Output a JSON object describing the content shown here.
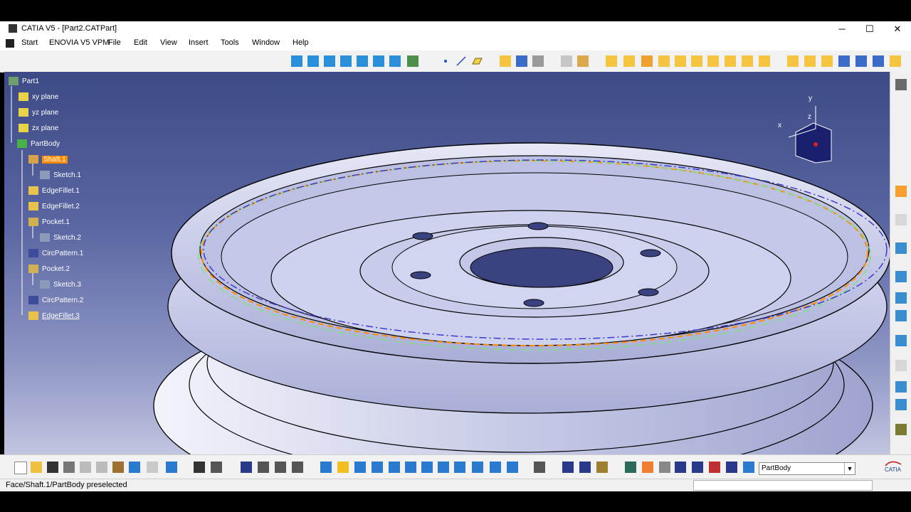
{
  "window": {
    "title": "CATIA V5 - [Part2.CATPart]",
    "min_glyph": "─",
    "max_glyph": "☐",
    "close_glyph": "✕"
  },
  "menu": {
    "items": [
      "Start",
      "ENOVIA V5 VPM",
      "File",
      "Edit",
      "View",
      "Insert",
      "Tools",
      "Window",
      "Help"
    ]
  },
  "tree": {
    "root": "Part1",
    "items": [
      {
        "label": "xy plane",
        "icon": "plane-icon"
      },
      {
        "label": "yz plane",
        "icon": "plane-icon"
      },
      {
        "label": "zx plane",
        "icon": "plane-icon"
      },
      {
        "label": "PartBody",
        "icon": "body-icon"
      },
      {
        "label": "Shaft.1",
        "icon": "shaft-icon"
      },
      {
        "label": "Sketch.1",
        "icon": "sketch-icon"
      },
      {
        "label": "EdgeFillet.1",
        "icon": "edge-fillet-icon"
      },
      {
        "label": "EdgeFillet.2",
        "icon": "edge-fillet-icon"
      },
      {
        "label": "Pocket.1",
        "icon": "pocket-icon"
      },
      {
        "label": "Sketch.2",
        "icon": "sketch-icon"
      },
      {
        "label": "CircPattern.1",
        "icon": "circ-pattern-icon"
      },
      {
        "label": "Pocket.2",
        "icon": "pocket-icon"
      },
      {
        "label": "Sketch.3",
        "icon": "sketch-icon"
      },
      {
        "label": "CircPattern.2",
        "icon": "circ-pattern-icon"
      },
      {
        "label": "EdgeFillet.3",
        "icon": "edge-fillet-icon"
      }
    ],
    "selected": "Shaft.1"
  },
  "compass": {
    "x_label": "x",
    "y_label": "y",
    "z_label": "z"
  },
  "toolbar": {
    "body_combo_value": "PartBody",
    "combo_arrow": "▼"
  },
  "status": {
    "text": "Face/Shaft.1/PartBody preselected"
  },
  "colors": {
    "accent": "#ff8c00",
    "viewport_top": "#3c4a86",
    "viewport_bottom": "#c1c5e0",
    "part": "#c8cbe8"
  }
}
